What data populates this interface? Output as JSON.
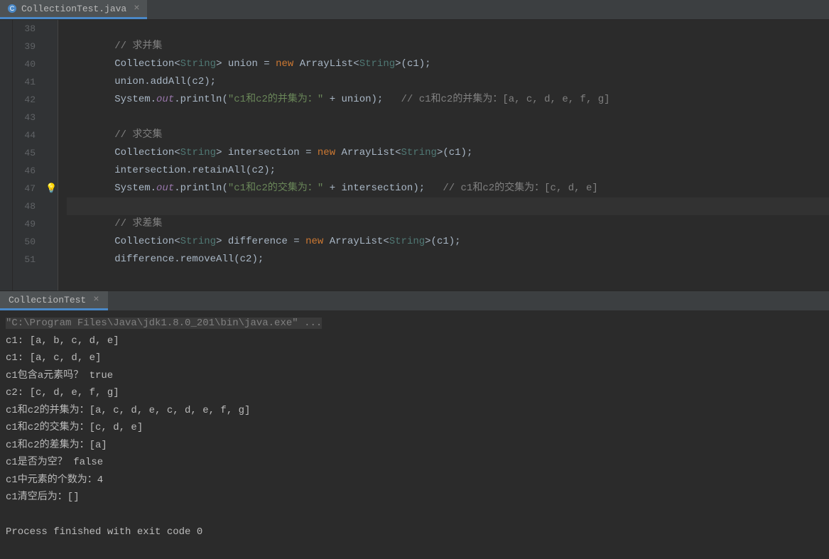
{
  "editor": {
    "tab": {
      "label": "CollectionTest.java"
    },
    "lines": [
      {
        "n": "38",
        "kind": "blank"
      },
      {
        "n": "39",
        "kind": "comment",
        "text": "// 求并集"
      },
      {
        "n": "40",
        "kind": "decl",
        "lhs1": "Collection<",
        "tp1": "String",
        "lhs2": "> union = ",
        "kw": "new",
        "rhs1": " ArrayList<",
        "tp2": "String",
        "rhs2": ">(c1);"
      },
      {
        "n": "41",
        "kind": "plain",
        "text": "union.addAll(c2);"
      },
      {
        "n": "42",
        "kind": "print",
        "pre": "System.",
        "field": "out",
        "mid": ".println(",
        "str": "\"c1和c2的并集为：\"",
        "post": " + union);",
        "trail": "   // c1和c2的并集为：[a, c, d, e, f, g]"
      },
      {
        "n": "43",
        "kind": "blank"
      },
      {
        "n": "44",
        "kind": "comment",
        "text": "// 求交集"
      },
      {
        "n": "45",
        "kind": "decl",
        "lhs1": "Collection<",
        "tp1": "String",
        "lhs2": "> intersection = ",
        "kw": "new",
        "rhs1": " ArrayList<",
        "tp2": "String",
        "rhs2": ">(c1);"
      },
      {
        "n": "46",
        "kind": "plain",
        "text": "intersection.retainAll(c2);"
      },
      {
        "n": "47",
        "kind": "print",
        "bulb": true,
        "pre": "System.",
        "field": "out",
        "mid": ".println(",
        "str": "\"c1和c2的交集为：\"",
        "post": " + intersection);",
        "trail": "   // c1和c2的交集为：[c, d, e]"
      },
      {
        "n": "48",
        "kind": "blank",
        "highlight": true
      },
      {
        "n": "49",
        "kind": "comment",
        "text": "// 求差集"
      },
      {
        "n": "50",
        "kind": "decl",
        "lhs1": "Collection<",
        "tp1": "String",
        "lhs2": "> difference = ",
        "kw": "new",
        "rhs1": " ArrayList<",
        "tp2": "String",
        "rhs2": ">(c1);"
      },
      {
        "n": "51",
        "kind": "plain",
        "text": "difference.removeAll(c2);"
      }
    ]
  },
  "run": {
    "tab": {
      "label": "CollectionTest"
    }
  },
  "console": {
    "cmd": "\"C:\\Program Files\\Java\\jdk1.8.0_201\\bin\\java.exe\" ...",
    "lines": [
      "c1: [a, b, c, d, e]",
      "c1: [a, c, d, e]",
      "c1包含a元素吗？ true",
      "c2: [c, d, e, f, g]",
      "c1和c2的并集为：[a, c, d, e, c, d, e, f, g]",
      "c1和c2的交集为：[c, d, e]",
      "c1和c2的差集为：[a]",
      "c1是否为空？ false",
      "c1中元素的个数为：4",
      "c1清空后为：[]",
      "",
      "Process finished with exit code 0"
    ]
  }
}
